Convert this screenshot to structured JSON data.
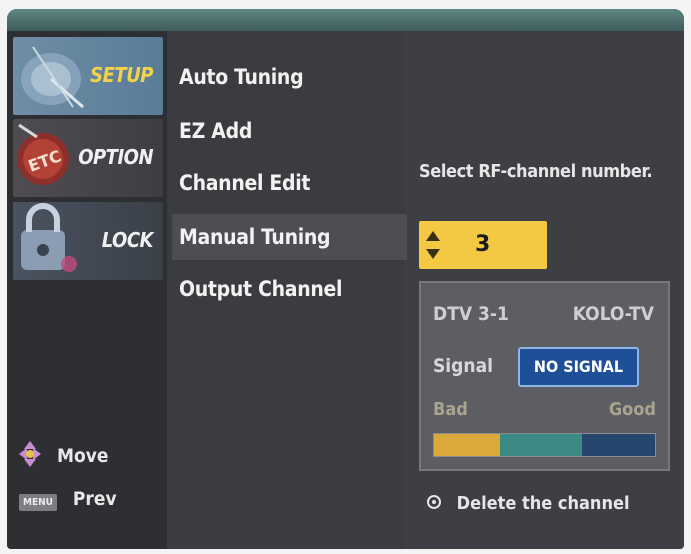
{
  "sidebar": {
    "tabs": [
      {
        "label": "SETUP"
      },
      {
        "label": "OPTION"
      },
      {
        "label": "LOCK"
      }
    ],
    "hints": {
      "move_label": "Move",
      "prev_label": "Prev",
      "menu_key_label": "MENU"
    }
  },
  "menu": {
    "items": [
      {
        "label": "Auto Tuning"
      },
      {
        "label": "EZ Add"
      },
      {
        "label": "Channel Edit"
      },
      {
        "label": "Manual Tuning"
      },
      {
        "label": "Output Channel"
      }
    ],
    "selected": "Manual Tuning"
  },
  "panel": {
    "prompt": "Select RF-channel number.",
    "channel_value": "3",
    "info": {
      "dtv_label": "DTV 3-1",
      "station": "KOLO-TV",
      "signal_label": "Signal",
      "signal_status": "NO SIGNAL",
      "bad_label": "Bad",
      "good_label": "Good"
    },
    "delete_label": "Delete the channel"
  },
  "colors": {
    "accent_setup": "#f2d24a",
    "channel_box": "#f3c944",
    "badge": "#1f4f96"
  }
}
